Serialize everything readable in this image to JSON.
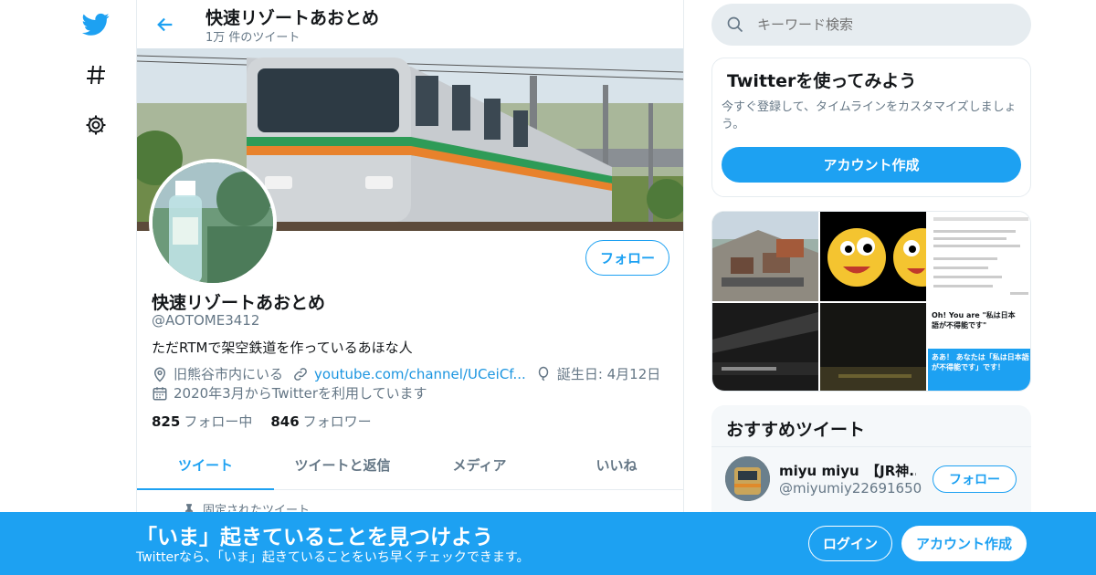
{
  "colors": {
    "accent": "#1da1f2",
    "secondary_text": "#657786",
    "link": "#1b95e0"
  },
  "nav": {
    "icons": [
      "twitter-logo-icon",
      "hashtag-icon",
      "gear-icon"
    ]
  },
  "header": {
    "title": "快速リゾートあおとめ",
    "subtitle": "1万 件のツイート"
  },
  "profile": {
    "follow_label": "フォロー",
    "name": "快速リゾートあおとめ",
    "handle": "@AOTOME3412",
    "bio": "ただRTMで架空鉄道を作っているあほな人",
    "location": "旧熊谷市内にいる",
    "website": "youtube.com/channel/UCeiCf...",
    "birthday": "誕生日: 4月12日",
    "joined": "2020年3月からTwitterを利用しています",
    "following_count": "825",
    "following_label": "フォロー中",
    "followers_count": "846",
    "followers_label": "フォロワー"
  },
  "tabs": [
    {
      "label": "ツイート",
      "active": true
    },
    {
      "label": "ツイートと返信",
      "active": false
    },
    {
      "label": "メディア",
      "active": false
    },
    {
      "label": "いいね",
      "active": false
    }
  ],
  "pinned_label": "固定されたツイート",
  "search": {
    "placeholder": "キーワード検索"
  },
  "signup_card": {
    "title": "Twitterを使ってみよう",
    "description": "今すぐ登録して、タイムラインをカスタマイズしましょう。",
    "button": "アカウント作成"
  },
  "media_thumb_text": {
    "question": "Oh! You are \"私は日本語が不得能です\"",
    "answer": "ああ！ あなたは「私は日本語が不得能です」です！"
  },
  "recommendations": {
    "title": "おすすめツイート",
    "items": [
      {
        "name": "miyu miyu　【JR神...",
        "handle": "@miyumiy22691650",
        "follow_label": "フォロー"
      }
    ]
  },
  "bottom_bar": {
    "title": "「いま」起きていることを見つけよう",
    "subtitle": "Twitterなら、「いま」起きていることをいち早くチェックできます。",
    "login": "ログイン",
    "signup": "アカウント作成"
  }
}
